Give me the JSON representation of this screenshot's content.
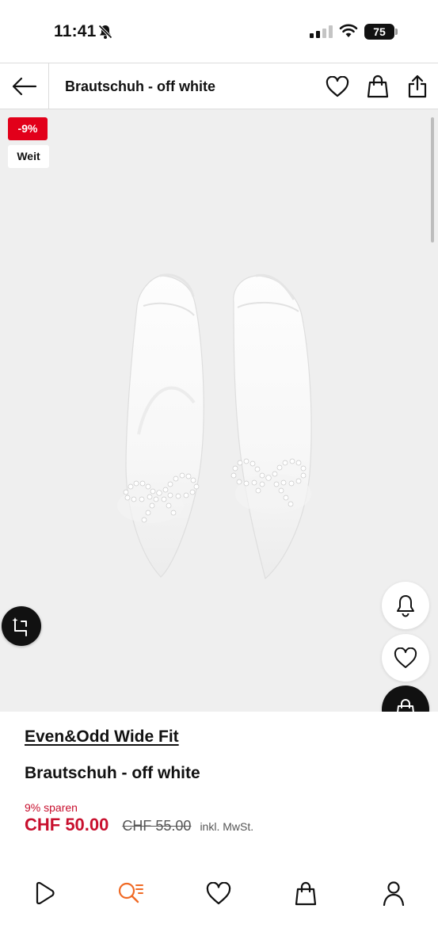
{
  "status_bar": {
    "time": "11:41",
    "battery_level": "75",
    "icons": [
      "bell-off-icon",
      "cellular-signal-icon",
      "wifi-icon",
      "battery-icon"
    ]
  },
  "nav": {
    "title": "Brautschuh - off white",
    "icons": [
      "back-arrow-icon",
      "heart-icon",
      "shopping-bag-icon",
      "share-icon"
    ]
  },
  "gallery": {
    "badges": {
      "discount": "-9%",
      "fit": "Weit"
    },
    "buttons": [
      "compare-icon",
      "bell-icon",
      "heart-icon",
      "shopping-bag-icon"
    ]
  },
  "product": {
    "brand": "Even&Odd Wide Fit",
    "name": "Brautschuh - off white",
    "savings": "9% sparen",
    "price_current": "CHF 50.00",
    "price_old": "CHF 55.00",
    "tax_note": "inkl. MwSt."
  },
  "tab_bar": {
    "items": [
      "play-icon",
      "search-list-icon",
      "heart-icon",
      "shopping-bag-icon",
      "profile-icon"
    ],
    "active_item": "search-list-icon"
  },
  "colors": {
    "sale_red": "#c8102e",
    "badge_red": "#e2001a",
    "active_tab_orange": "#f06a25",
    "gallery_background": "#efefef",
    "text": "#111111"
  }
}
